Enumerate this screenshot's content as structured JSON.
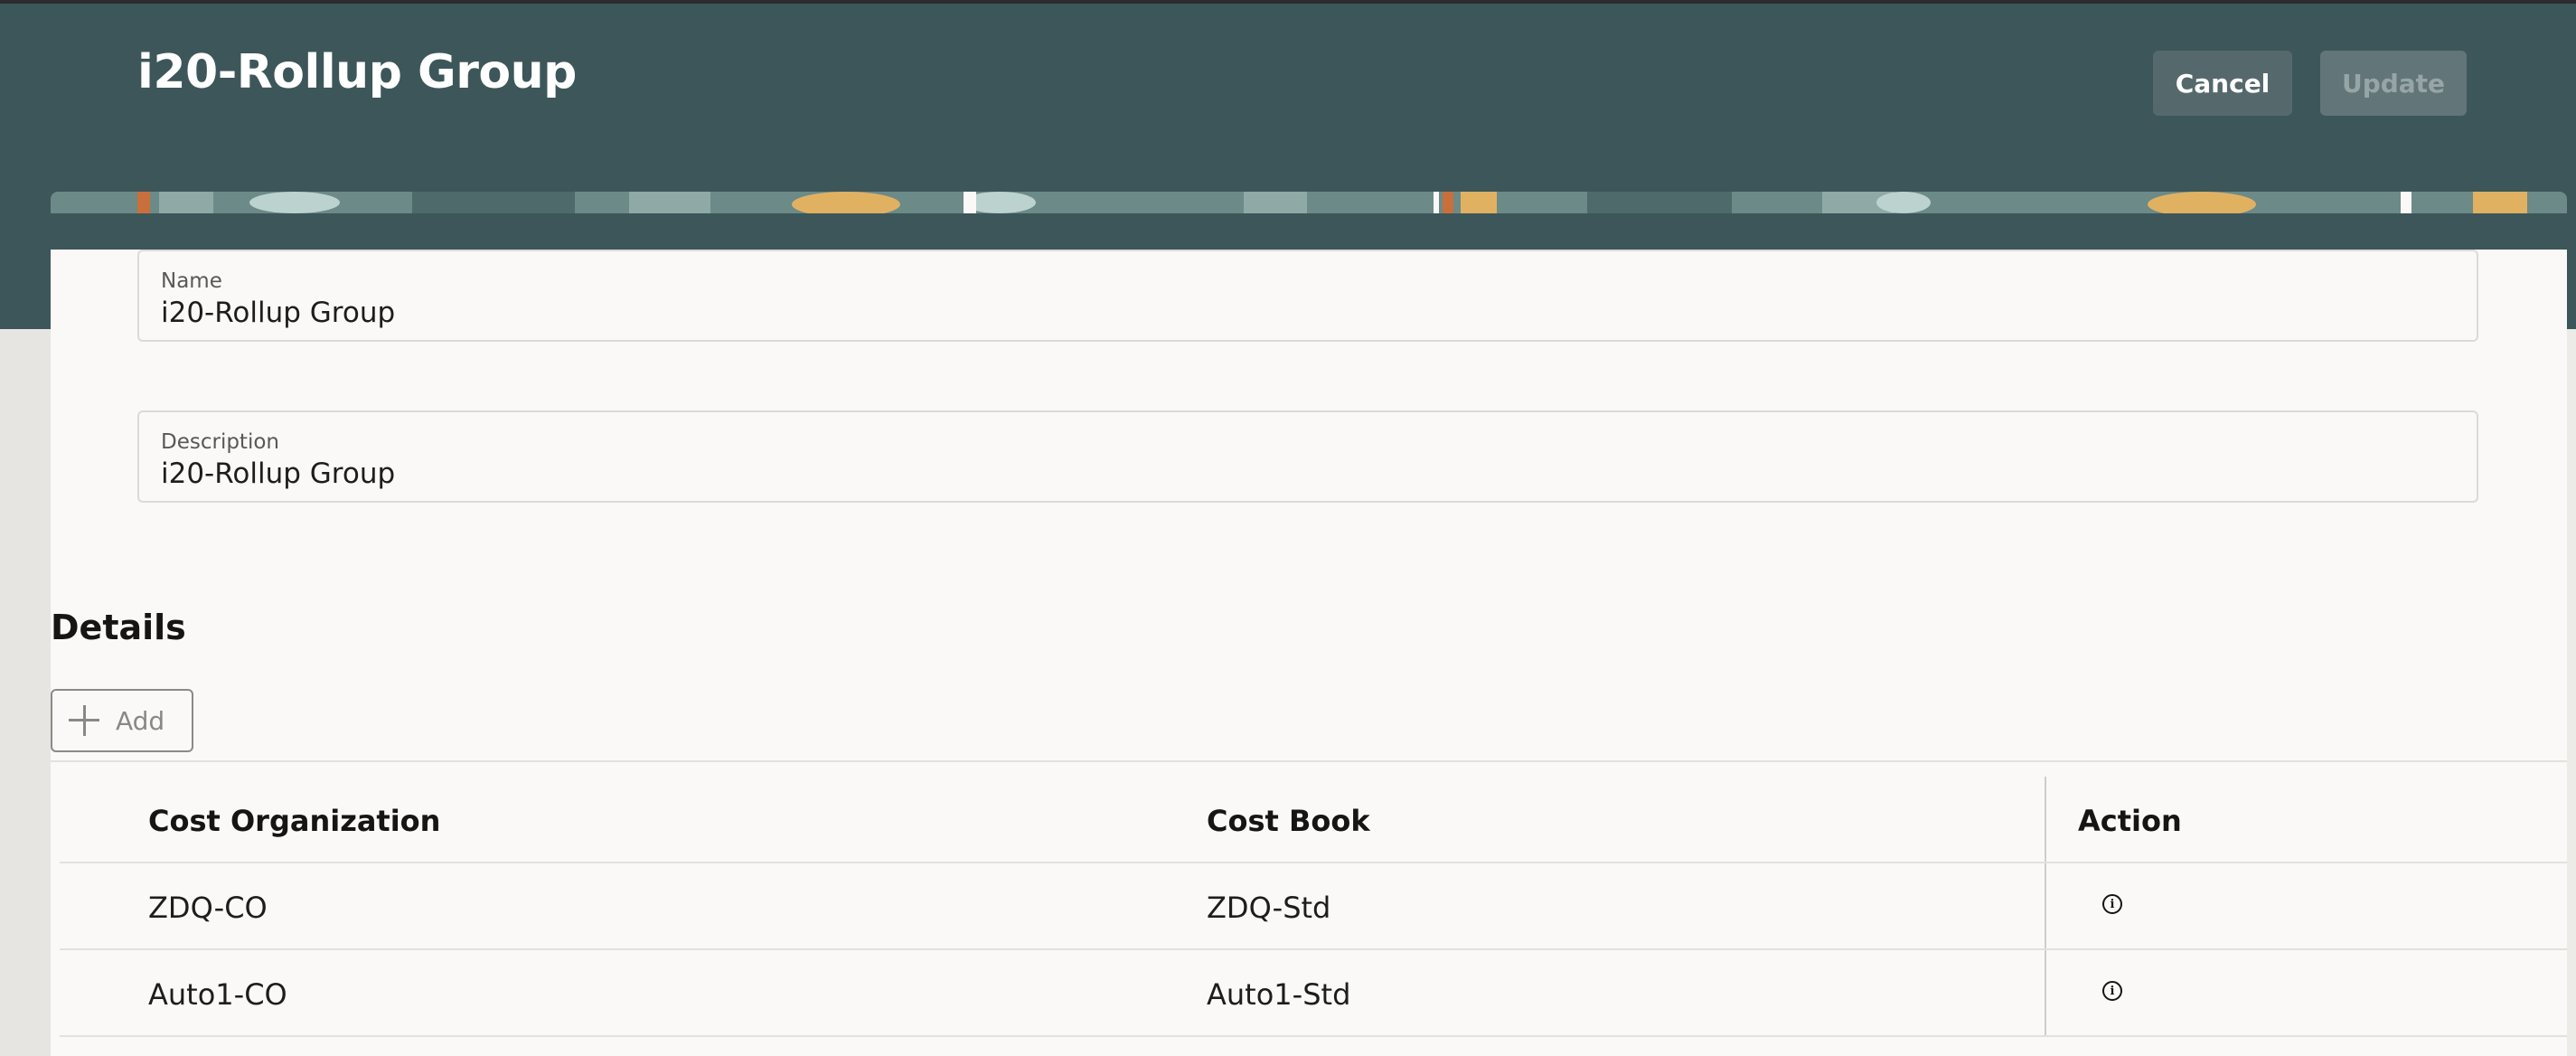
{
  "header": {
    "title": "i20-Rollup Group",
    "cancel_label": "Cancel",
    "update_label": "Update"
  },
  "form": {
    "name": {
      "label": "Name",
      "value": "i20-Rollup Group"
    },
    "description": {
      "label": "Description",
      "value": "i20-Rollup Group"
    }
  },
  "details": {
    "title": "Details",
    "add_label": "Add",
    "columns": [
      "Cost Organization",
      "Cost Book",
      "Action"
    ],
    "rows": [
      {
        "cost_organization": "ZDQ-CO",
        "cost_book": "ZDQ-Std",
        "action_icon": "info-icon"
      },
      {
        "cost_organization": "Auto1-CO",
        "cost_book": "Auto1-Std",
        "action_icon": "info-icon"
      }
    ]
  },
  "colors": {
    "header_bg": "#3d5659",
    "card_bg": "#faf9f7",
    "cancel_bg": "#55696c",
    "update_bg": "#627578"
  }
}
